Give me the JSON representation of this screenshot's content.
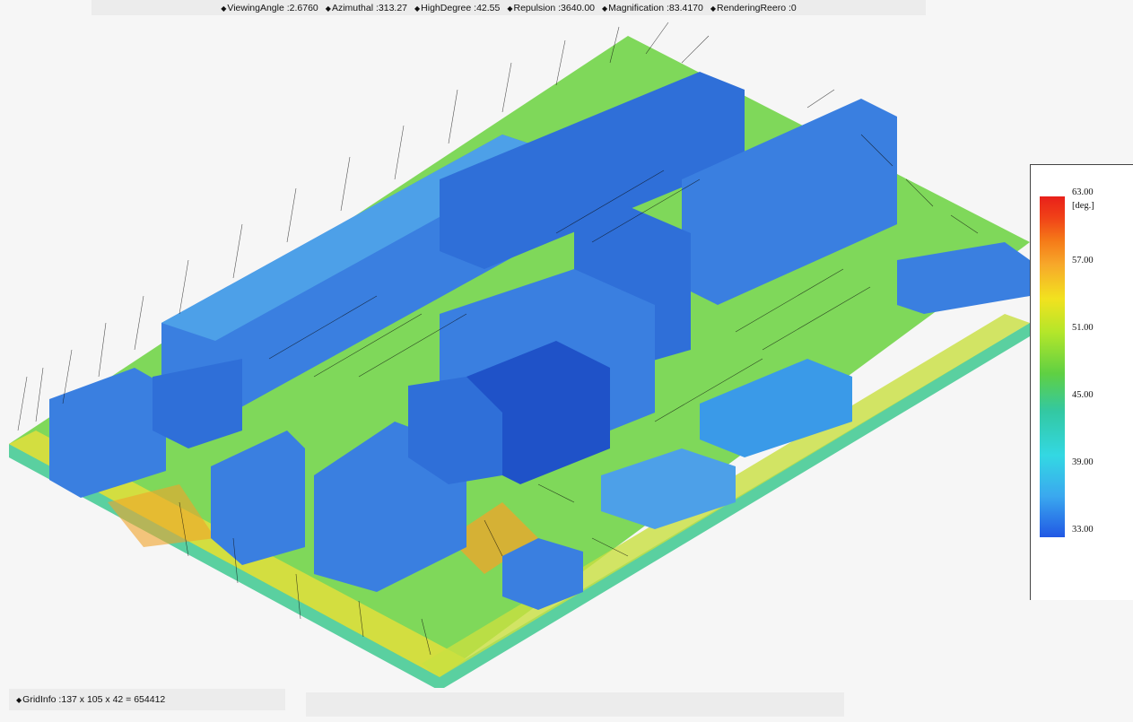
{
  "header": {
    "params": [
      {
        "label": "ViewingAngle",
        "value": "2.6760"
      },
      {
        "label": "Azimuthal",
        "value": "313.27"
      },
      {
        "label": "HighDegree",
        "value": "42.55"
      },
      {
        "label": "Repulsion",
        "value": "3640.00"
      },
      {
        "label": "Magnification",
        "value": "83.4170"
      },
      {
        "label": "RenderingReero",
        "value": "0"
      }
    ]
  },
  "legend": {
    "unit": "[deg.]",
    "ticks": [
      "63.00",
      "57.00",
      "51.00",
      "45.00",
      "39.00",
      "33.00"
    ],
    "colors": {
      "max": "#e8201a",
      "mid": "#5fd043",
      "min": "#2158e4"
    }
  },
  "footer": {
    "grid_info_label": "GridInfo",
    "grid_info_value": "137 x 105 x 42 = 654412"
  },
  "scene": {
    "colors": {
      "ground": "#7fd85a",
      "ground_edge": "#e9e03a",
      "building": "#3a7fe0",
      "building_dark": "#1f52c8",
      "building_roof": "#4da0e8",
      "vectors": "#0a0a0a",
      "base_front": "#5ad0a0",
      "base_side": "#c9e040"
    }
  }
}
